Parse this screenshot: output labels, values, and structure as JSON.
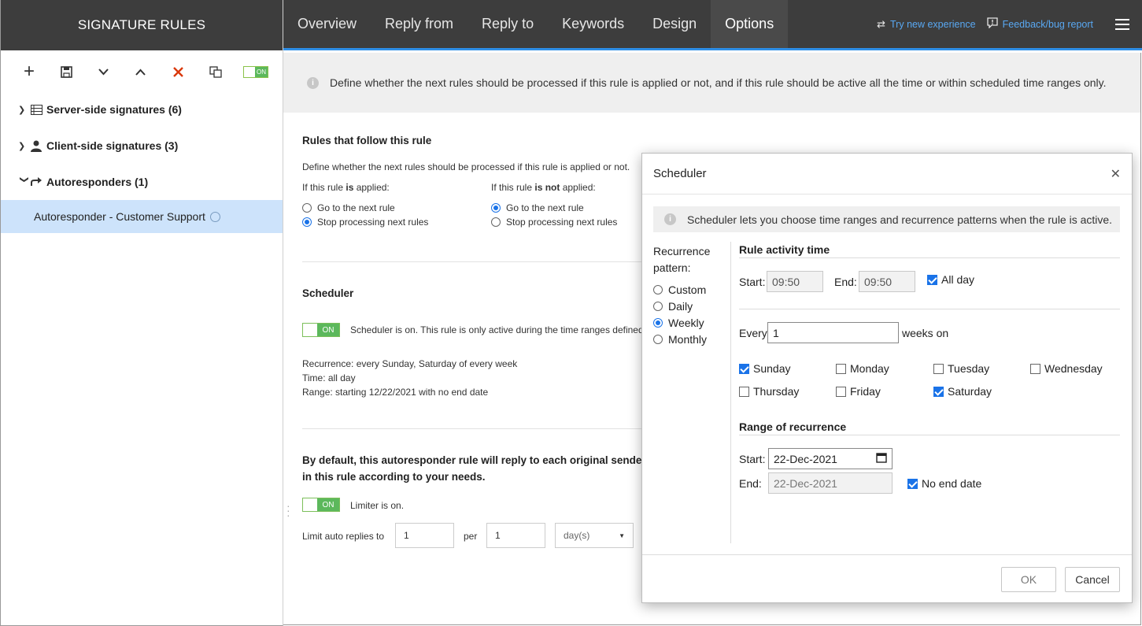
{
  "sidebar": {
    "title": "SIGNATURE RULES",
    "toggle_label": "ON",
    "nodes": [
      {
        "label": "Server-side signatures (6)"
      },
      {
        "label": "Client-side signatures (3)"
      },
      {
        "label": "Autoresponders (1)"
      }
    ],
    "selected_item": "Autoresponder - Customer Support"
  },
  "nav": {
    "tabs": [
      "Overview",
      "Reply from",
      "Reply to",
      "Keywords",
      "Design",
      "Options"
    ],
    "active": "Options",
    "try_new": "Try new experience",
    "feedback": "Feedback/bug report"
  },
  "main": {
    "banner": "Define whether the next rules should be processed if this rule is applied or not, and if this rule should be active all the time or within scheduled time ranges only.",
    "rules_follow": {
      "title": "Rules that follow this rule",
      "desc": "Define whether the next rules should be processed if this rule is applied or not.",
      "applied_prefix": "If this rule ",
      "applied_bold": "is",
      "applied_suffix": " applied:",
      "notapplied_prefix": "If this rule ",
      "notapplied_bold": "is not",
      "notapplied_suffix": " applied:",
      "opt_go": "Go to the next rule",
      "opt_stop": "Stop processing next rules"
    },
    "scheduler": {
      "title": "Scheduler",
      "toggle": "ON",
      "status": "Scheduler is on. This rule is only active during the time ranges defined",
      "recurrence": "Recurrence: every Sunday, Saturday of every week",
      "time": "Time: all day",
      "range": "Range: starting 12/22/2021 with no end date"
    },
    "limiter": {
      "text1": "By default, this autoresponder rule will reply to each original sender",
      "text2": "in this rule according to your needs.",
      "toggle": "ON",
      "status": "Limiter is on.",
      "limit_label": "Limit auto replies to",
      "limit_value": "1",
      "per_label": "per",
      "per_value": "1",
      "unit": "day(s)"
    }
  },
  "modal": {
    "title": "Scheduler",
    "info": "Scheduler lets you choose time ranges and recurrence patterns when the rule is active.",
    "pattern_label_1": "Recurrence",
    "pattern_label_2": "pattern:",
    "patterns": [
      "Custom",
      "Daily",
      "Weekly",
      "Monthly"
    ],
    "selected_pattern": "Weekly",
    "activity_title": "Rule activity time",
    "start_label": "Start:",
    "start_time": "09:50",
    "end_label": "End:",
    "end_time": "09:50",
    "all_day": "All day",
    "every_label": "Every",
    "every_value": "1",
    "weeks_on": "weeks on",
    "days": [
      "Sunday",
      "Monday",
      "Tuesday",
      "Wednesday",
      "Thursday",
      "Friday",
      "Saturday"
    ],
    "range_title": "Range of recurrence",
    "range_start_label": "Start:",
    "range_start": "22-Dec-2021",
    "range_end_label": "End:",
    "range_end": "22-Dec-2021",
    "no_end": "No end date",
    "ok": "OK",
    "cancel": "Cancel"
  }
}
